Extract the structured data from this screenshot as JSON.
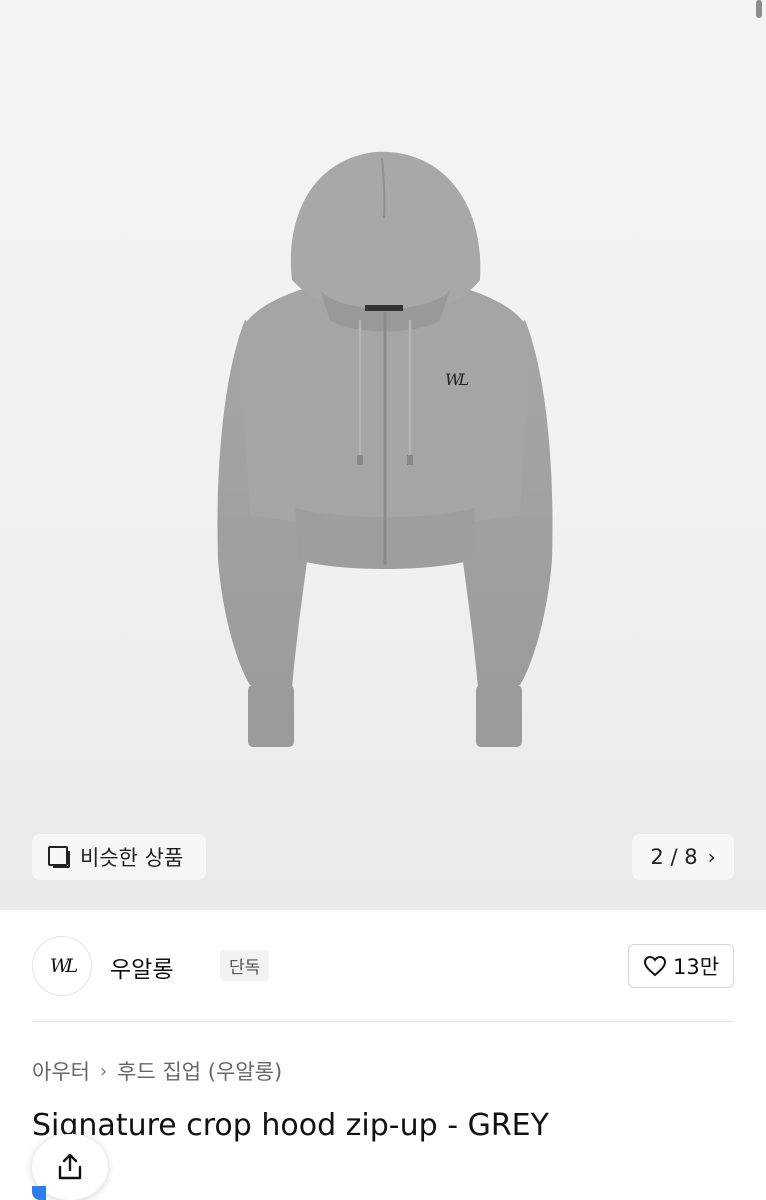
{
  "image": {
    "subject": "grey cropped zip-up hoodie",
    "logo_mark": "WL"
  },
  "gallery": {
    "similar_label": "비슷한 상품",
    "page_indicator": "2 / 8",
    "current_page": 2,
    "total_pages": 8
  },
  "brand": {
    "logo_text": "WL",
    "name": "우알롱",
    "badge": "단독"
  },
  "like": {
    "count": "13만"
  },
  "breadcrumb": {
    "items": [
      "아우터",
      "후드 집업 (우알롱)"
    ]
  },
  "product": {
    "title": "Signature crop hood zip-up - GREY"
  },
  "colors": {
    "garment_grey": "#a3a3a3",
    "accent": "#2b7de9"
  }
}
